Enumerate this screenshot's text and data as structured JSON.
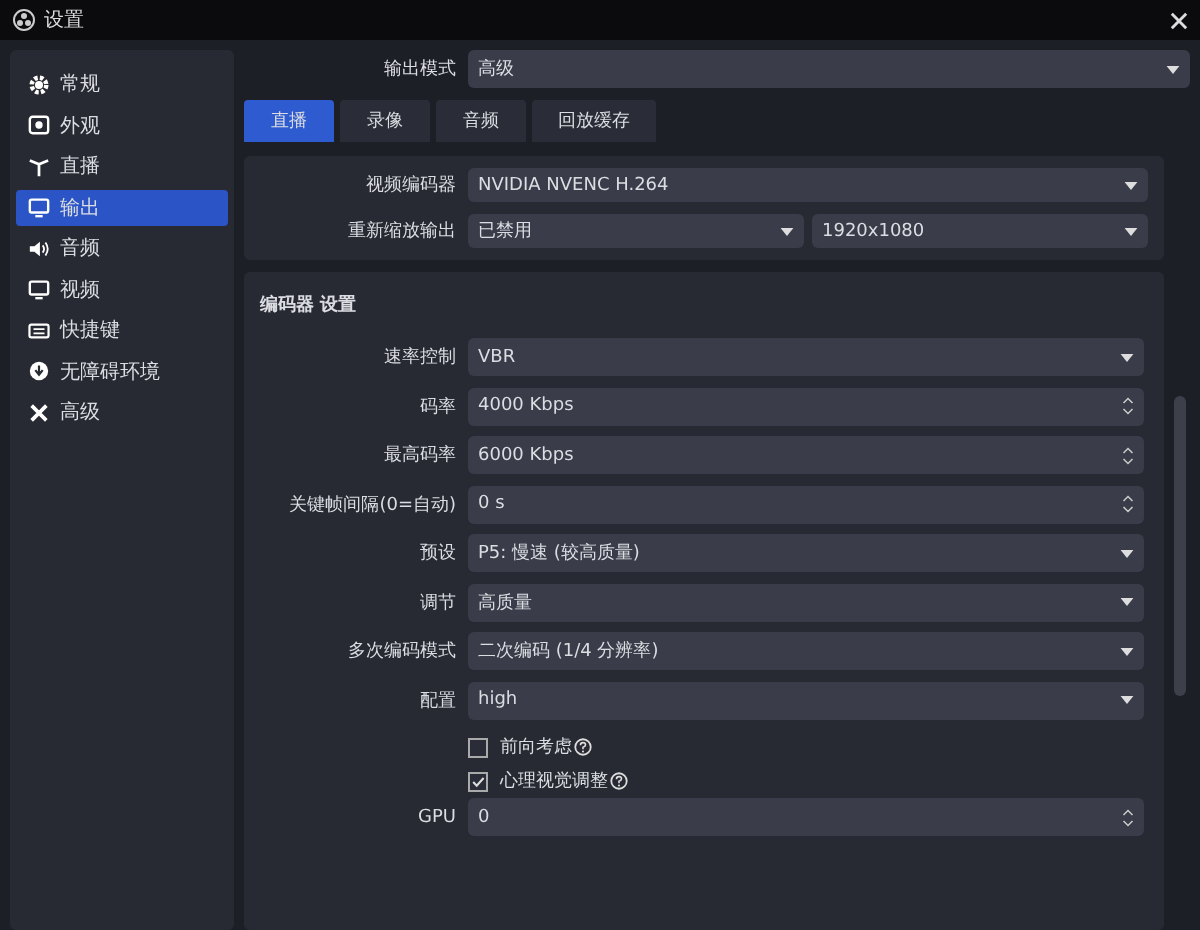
{
  "window": {
    "title": "设置"
  },
  "sidebar": {
    "items": [
      {
        "label": "常规",
        "selected": false
      },
      {
        "label": "外观",
        "selected": false
      },
      {
        "label": "直播",
        "selected": false
      },
      {
        "label": "输出",
        "selected": true
      },
      {
        "label": "音频",
        "selected": false
      },
      {
        "label": "视频",
        "selected": false
      },
      {
        "label": "快捷键",
        "selected": false
      },
      {
        "label": "无障碍环境",
        "selected": false
      },
      {
        "label": "高级",
        "selected": false
      }
    ]
  },
  "output_mode": {
    "label": "输出模式",
    "value": "高级"
  },
  "tabs": [
    {
      "label": "直播",
      "selected": true
    },
    {
      "label": "录像",
      "selected": false
    },
    {
      "label": "音频",
      "selected": false
    },
    {
      "label": "回放缓存",
      "selected": false
    }
  ],
  "stream_panel": {
    "rows": [
      {
        "label": "视频编码器",
        "values": [
          "NVIDIA NVENC H.264"
        ]
      },
      {
        "label": "重新缩放输出",
        "values": [
          "已禁用",
          "1920x1080"
        ]
      }
    ]
  },
  "encoder_settings": {
    "title": "编码器 设置",
    "rows": [
      {
        "kind": "select",
        "label": "速率控制",
        "value": "VBR"
      },
      {
        "kind": "spin",
        "label": "码率",
        "value": "4000 Kbps"
      },
      {
        "kind": "spin",
        "label": "最高码率",
        "value": "6000 Kbps"
      },
      {
        "kind": "spin",
        "label": "关键帧间隔(0=自动)",
        "value": "0 s"
      },
      {
        "kind": "select",
        "label": "预设",
        "value": "P5: 慢速 (较高质量)"
      },
      {
        "kind": "select",
        "label": "调节",
        "value": "高质量"
      },
      {
        "kind": "select",
        "label": "多次编码模式",
        "value": "二次编码 (1/4 分辨率)"
      },
      {
        "kind": "select",
        "label": "配置",
        "value": "high"
      },
      {
        "kind": "checkbox",
        "label": "前向考虑",
        "checked": false
      },
      {
        "kind": "checkbox",
        "label": "心理视觉调整",
        "checked": true
      },
      {
        "kind": "spin",
        "label": "GPU",
        "value": "0"
      }
    ]
  }
}
